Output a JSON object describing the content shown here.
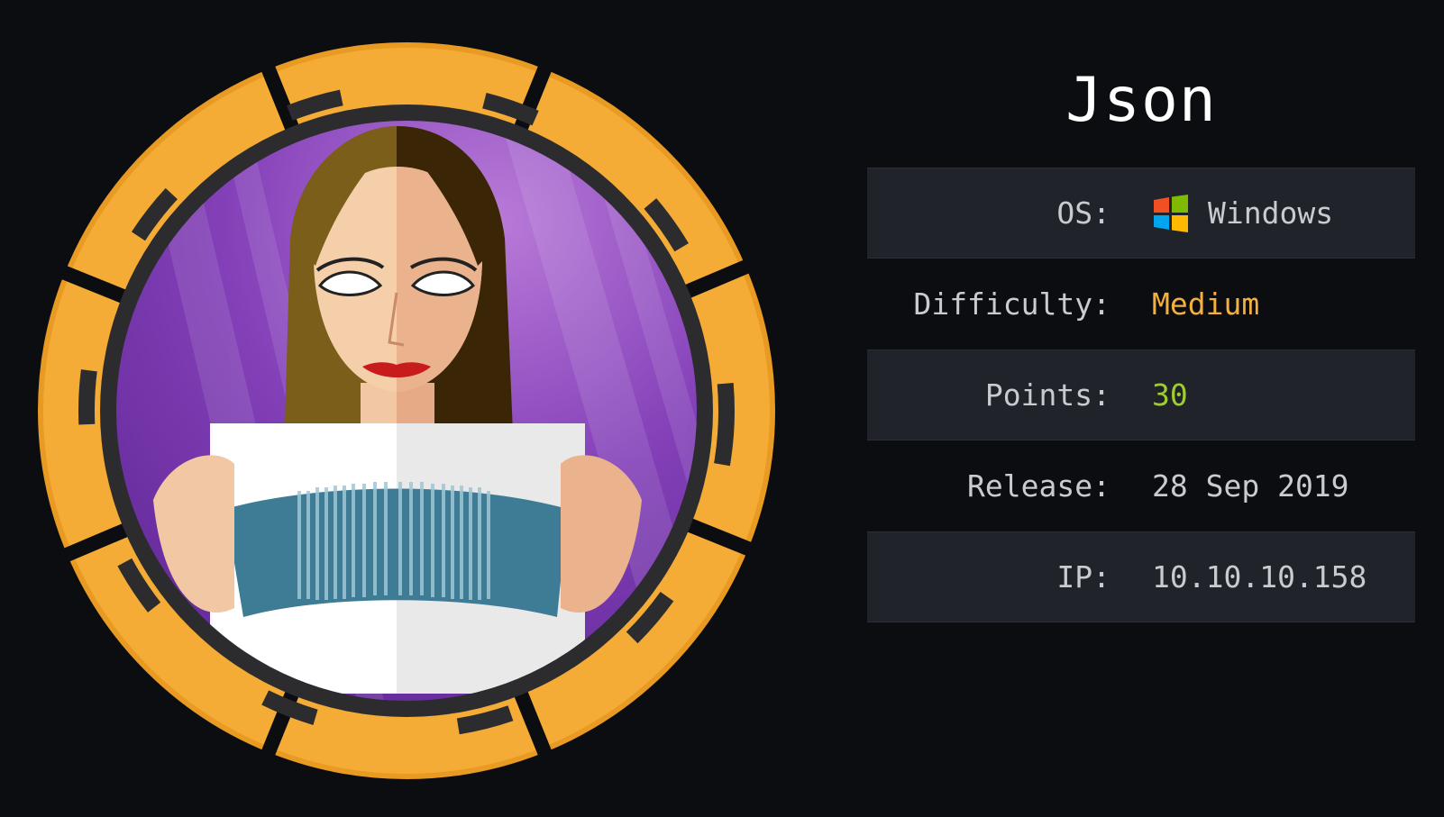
{
  "machine": {
    "name": "Json"
  },
  "info": {
    "os": {
      "label": "OS:",
      "value": "Windows",
      "icon": "windows-logo-icon"
    },
    "difficulty": {
      "label": "Difficulty:",
      "value": "Medium",
      "color": "#f4b03e"
    },
    "points": {
      "label": "Points:",
      "value": "30",
      "color": "#9fcc2e"
    },
    "release": {
      "label": "Release:",
      "value": "28 Sep 2019"
    },
    "ip": {
      "label": "IP:",
      "value": "10.10.10.158"
    }
  },
  "colors": {
    "background": "#0b0d10",
    "row_shade": "#20242a",
    "ring_orange": "#f4ac36",
    "ring_dark": "#2c2c2e",
    "art_purple": "#7b3fb0"
  }
}
